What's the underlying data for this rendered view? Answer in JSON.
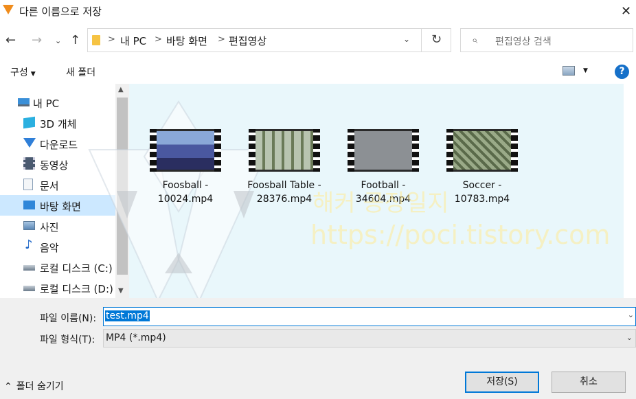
{
  "window": {
    "title": "다른 이름으로 저장",
    "close_glyph": "✕"
  },
  "nav": {
    "back_glyph": "←",
    "forward_glyph": "→",
    "recent_glyph": "⌄",
    "up_glyph": "↑"
  },
  "address": {
    "crumbs": [
      "내 PC",
      "바탕 화면",
      "편집영상"
    ],
    "separator": ">",
    "dropdown_glyph": "⌄",
    "refresh_glyph": "↻"
  },
  "search": {
    "placeholder": "편집영상 검색",
    "icon_glyph": "⌕"
  },
  "toolbar": {
    "organize_label": "구성",
    "organize_caret": "▼",
    "new_folder_label": "새 폴더",
    "view_caret": "▼",
    "help_label": "?"
  },
  "sidebar": {
    "items": [
      {
        "label": "내 PC",
        "icon": "computer-icon",
        "color": "#3a8fd8"
      },
      {
        "label": "3D 개체",
        "icon": "cube-icon",
        "color": "#2bb0e0"
      },
      {
        "label": "다운로드",
        "icon": "download-icon",
        "color": "#2f7fd8"
      },
      {
        "label": "동영상",
        "icon": "film-icon",
        "color": "#4a5a70"
      },
      {
        "label": "문서",
        "icon": "document-icon",
        "color": "#8aa0b8"
      },
      {
        "label": "바탕 화면",
        "icon": "desktop-icon",
        "color": "#2e86d9",
        "selected": true
      },
      {
        "label": "사진",
        "icon": "pictures-icon",
        "color": "#5b88b6"
      },
      {
        "label": "음악",
        "icon": "music-icon",
        "color": "#2068c8"
      },
      {
        "label": "로컬 디스크 (C:)",
        "icon": "drive-c-icon",
        "color": "#6b7b8b"
      },
      {
        "label": "로컬 디스크 (D:)",
        "icon": "drive-d-icon",
        "color": "#6b7b8b"
      }
    ],
    "scroll_up_glyph": "▲",
    "scroll_down_glyph": "▼"
  },
  "files": [
    {
      "line1": "Foosball -",
      "line2": "10024.mp4",
      "thumb_color": "#4a58a0"
    },
    {
      "line1": "Foosball Table -",
      "line2": "28376.mp4",
      "thumb_color": "#8a9a78"
    },
    {
      "line1": "Football -",
      "line2": "34604.mp4",
      "thumb_color": "#8c9094"
    },
    {
      "line1": "Soccer -",
      "line2": "10783.mp4",
      "thumb_color": "#6a7a5a"
    }
  ],
  "watermark": {
    "title": "해커 공장일지",
    "url": "https://poci.tistory.com"
  },
  "footer": {
    "filename_label": "파일 이름(N):",
    "filename_value": "test.mp4",
    "filetype_label": "파일 형식(T):",
    "filetype_value": "MP4 (*.mp4)",
    "dropdown_glyph": "⌄",
    "hide_folders_label": "폴더 숨기기",
    "hide_folders_glyph": "⌃",
    "save_label": "저장(S)",
    "cancel_label": "취소"
  },
  "colors": {
    "selection": "#cce8ff",
    "accent": "#0078d7",
    "content_bg": "#e9f7fb",
    "footer_bg": "#f0f0f0"
  }
}
